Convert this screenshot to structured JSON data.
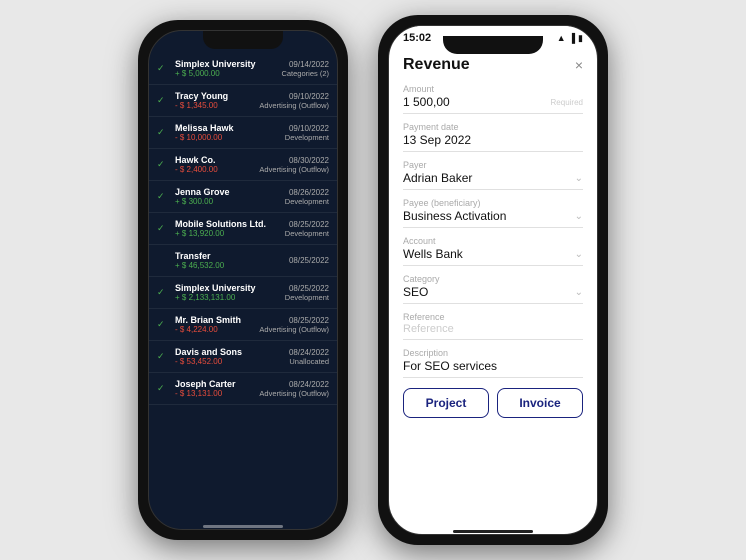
{
  "left_phone": {
    "transactions": [
      {
        "name": "Simplex University",
        "amount": "+ $ 5,000.00",
        "positive": true,
        "date": "09/14/2022",
        "category": "Categories (2)",
        "checked": true
      },
      {
        "name": "Tracy Young",
        "amount": "- $ 1,345.00",
        "positive": false,
        "date": "09/10/2022",
        "category": "Advertising (Outflow)",
        "checked": true
      },
      {
        "name": "Melissa Hawk",
        "amount": "- $ 10,000.00",
        "positive": false,
        "date": "09/10/2022",
        "category": "Development",
        "checked": true
      },
      {
        "name": "Hawk Co.",
        "amount": "- $ 2,400.00",
        "positive": false,
        "date": "08/30/2022",
        "category": "Advertising (Outflow)",
        "checked": true
      },
      {
        "name": "Jenna Grove",
        "amount": "+ $ 300.00",
        "positive": true,
        "date": "08/26/2022",
        "category": "Development",
        "checked": true
      },
      {
        "name": "Mobile Solutions Ltd.",
        "amount": "+ $ 13,920.00",
        "positive": true,
        "date": "08/25/2022",
        "category": "Development",
        "checked": true
      },
      {
        "name": "Transfer",
        "amount": "+ $ 46,532.00",
        "positive": true,
        "date": "08/25/2022",
        "category": "",
        "checked": false
      },
      {
        "name": "Simplex University",
        "amount": "+ $ 2,133,131.00",
        "positive": true,
        "date": "08/25/2022",
        "category": "Development",
        "checked": true
      },
      {
        "name": "Mr. Brian Smith",
        "amount": "- $ 4,224.00",
        "positive": false,
        "date": "08/25/2022",
        "category": "Advertising (Outflow)",
        "checked": true
      },
      {
        "name": "Davis and Sons",
        "amount": "- $ 53,452.00",
        "positive": false,
        "date": "08/24/2022",
        "category": "Unallocated",
        "checked": true
      },
      {
        "name": "Joseph Carter",
        "amount": "- $ 13,131.00",
        "positive": false,
        "date": "08/24/2022",
        "category": "Advertising (Outflow)",
        "checked": true
      }
    ]
  },
  "right_phone": {
    "status_time": "15:02",
    "modal": {
      "title": "Revenue",
      "close": "×",
      "fields": [
        {
          "label": "Amount",
          "value": "1 500,00",
          "required": "Required",
          "type": "value",
          "has_chevron": false
        },
        {
          "label": "Payment date",
          "value": "13 Sep 2022",
          "type": "center",
          "has_chevron": false
        },
        {
          "label": "Payer",
          "value": "Adrian Baker",
          "type": "dropdown",
          "has_chevron": true
        },
        {
          "label": "Payee (beneficiary)",
          "value": "Business Activation",
          "type": "dropdown",
          "has_chevron": true
        },
        {
          "label": "Account",
          "value": "Wells Bank",
          "type": "dropdown",
          "has_chevron": true
        },
        {
          "label": "Category",
          "value": "SEO",
          "type": "dropdown",
          "has_chevron": true
        },
        {
          "label": "Reference",
          "value": "",
          "type": "placeholder",
          "has_chevron": false
        },
        {
          "label": "Description",
          "value": "For SEO services",
          "type": "value",
          "has_chevron": false
        }
      ],
      "buttons": [
        "Project",
        "Invoice"
      ]
    }
  }
}
